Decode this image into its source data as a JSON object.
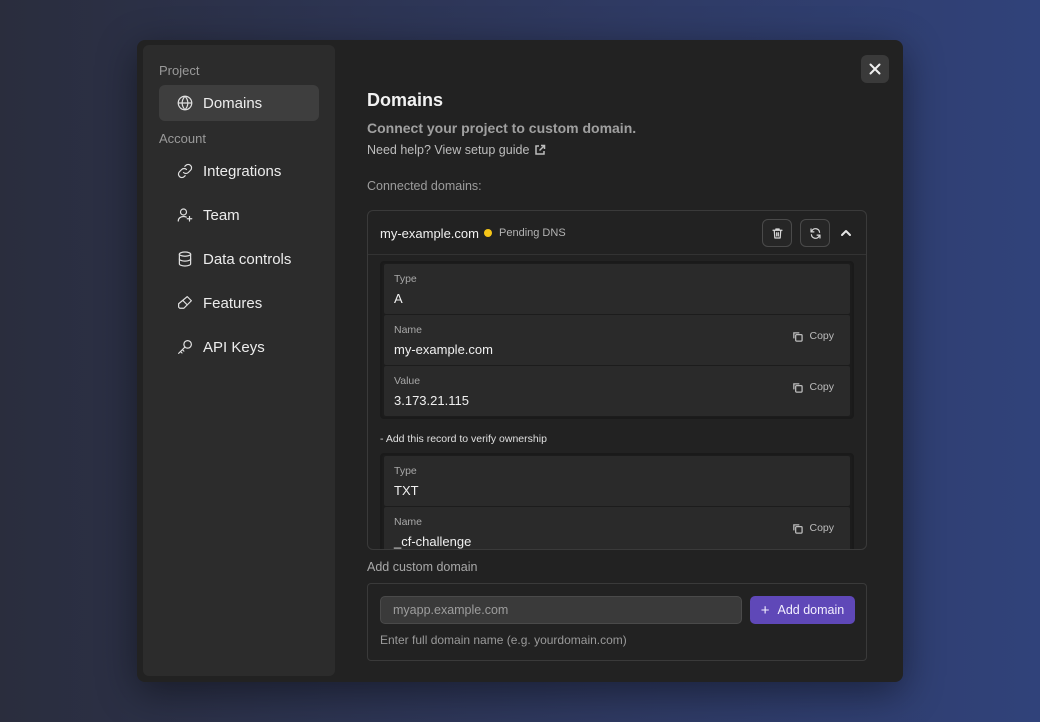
{
  "sidebar": {
    "project_label": "Project",
    "account_label": "Account",
    "items": [
      {
        "label": "Domains",
        "icon": "globe-icon"
      },
      {
        "label": "Integrations",
        "icon": "link-icon"
      },
      {
        "label": "Team",
        "icon": "user-plus-icon"
      },
      {
        "label": "Data controls",
        "icon": "database-icon"
      },
      {
        "label": "Features",
        "icon": "eraser-icon"
      },
      {
        "label": "API Keys",
        "icon": "key-icon"
      }
    ],
    "active": "Domains"
  },
  "main": {
    "title": "Domains",
    "subtitle": "Connect your project to custom domain.",
    "help_text": "Need help? View setup guide",
    "connected_label": "Connected domains:",
    "domain": {
      "name": "my-example.com",
      "status": "Pending DNS",
      "status_color": "#f5c518",
      "records_a": [
        {
          "label": "Type",
          "value": "A"
        },
        {
          "label": "Name",
          "value": "my-example.com",
          "copy": "Copy"
        },
        {
          "label": "Value",
          "value": "3.173.21.115",
          "copy": "Copy"
        }
      ],
      "verify_note": "- Add this record to verify ownership",
      "records_txt": [
        {
          "label": "Type",
          "value": "TXT"
        },
        {
          "label": "Name",
          "value": "_cf-challenge",
          "copy": "Copy"
        }
      ]
    },
    "add": {
      "label": "Add custom domain",
      "placeholder": "myapp.example.com",
      "button": "Add domain",
      "hint": "Enter full domain name (e.g. yourdomain.com)"
    }
  },
  "colors": {
    "accent": "#5f48b8",
    "background": "#222222"
  }
}
